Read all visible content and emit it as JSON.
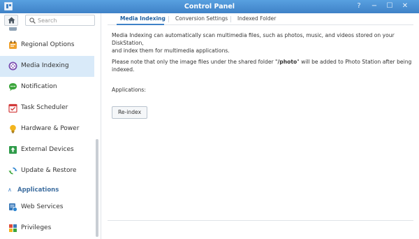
{
  "window": {
    "title": "Control Panel",
    "controls": {
      "help": "?",
      "minimize": "−",
      "maximize": "☐",
      "close": "✕"
    }
  },
  "sidebar": {
    "search_placeholder": "Search",
    "items": [
      {
        "label": "Regional Options",
        "icon": "regional-options-icon"
      },
      {
        "label": "Media Indexing",
        "icon": "media-indexing-icon",
        "active": true
      },
      {
        "label": "Notification",
        "icon": "notification-icon"
      },
      {
        "label": "Task Scheduler",
        "icon": "task-scheduler-icon"
      },
      {
        "label": "Hardware & Power",
        "icon": "hardware-power-icon"
      },
      {
        "label": "External Devices",
        "icon": "external-devices-icon"
      },
      {
        "label": "Update & Restore",
        "icon": "update-restore-icon"
      }
    ],
    "section": {
      "label": "Applications",
      "chevron": "∧"
    },
    "app_items": [
      {
        "label": "Web Services",
        "icon": "web-services-icon"
      },
      {
        "label": "Privileges",
        "icon": "privileges-icon"
      }
    ]
  },
  "tabs": [
    {
      "label": "Media Indexing",
      "active": true
    },
    {
      "label": "Conversion Settings"
    },
    {
      "label": "Indexed Folder"
    }
  ],
  "main": {
    "description_line1": "Media Indexing can automatically scan multimedia files, such as photos, music, and videos stored on your DiskStation,",
    "description_line2": "and index them for multimedia applications.",
    "note_prefix": "Please note that only the image files under the shared folder \"",
    "note_folder": "/photo",
    "note_suffix": "\" will be added to Photo Station after being",
    "note_line2": "indexed.",
    "applications_label": "Applications:",
    "reindex_button": "Re-index"
  },
  "colors": {
    "titlebar": "#3f82c7",
    "active_item_bg": "#d9eaf9",
    "active_tab": "#1f5f9f"
  }
}
